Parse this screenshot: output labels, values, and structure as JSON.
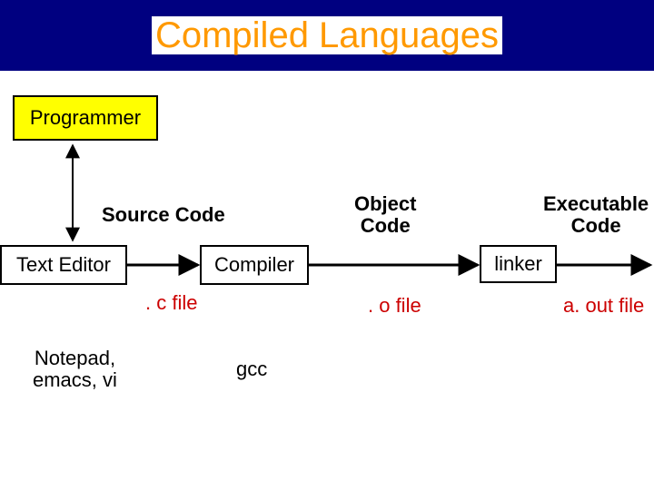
{
  "title": "Compiled Languages",
  "nodes": {
    "programmer": "Programmer",
    "editor": "Text Editor",
    "compiler": "Compiler",
    "linker": "linker"
  },
  "labels": {
    "source_code": "Source Code",
    "object_code": "Object\nCode",
    "exec_code": "Executable\nCode",
    "c_file": ". c file",
    "o_file": ". o file",
    "out_file": "a. out file",
    "editor_examples": "Notepad,\nemacs, vi",
    "compiler_example": "gcc"
  }
}
